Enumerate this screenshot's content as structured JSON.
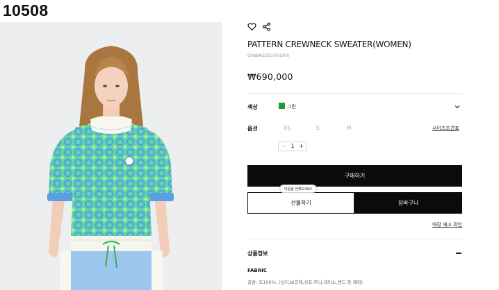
{
  "product_code_overlay": "10508",
  "product": {
    "name": "PATTERN CREWNECK SWEATER(WOMEN)",
    "sku": "GNWAS25205GRX",
    "price": "₩690,000"
  },
  "icons": {
    "wishlist": "heart-icon",
    "share": "share-icon",
    "expand": "chevron-down-icon",
    "collapse": "minus-icon"
  },
  "color": {
    "label": "색상",
    "value": "그린",
    "swatch": "#1b9a3b"
  },
  "size": {
    "label": "옵션",
    "options": [
      "XS",
      "S",
      "M"
    ],
    "guide_label": "사이즈조견표"
  },
  "quantity": {
    "minus": "−",
    "value": "1",
    "plus": "+"
  },
  "buttons": {
    "buy": "구매하기",
    "gift": "선물하기",
    "cart": "장바구니",
    "gift_tooltip": "마음을 전해보세요!"
  },
  "stock_check": "매장 재고 확인",
  "info": {
    "label": "상품정보",
    "fabric_label": "FABRIC",
    "fabric_detail": "겉감: 모100%, (심지,보강재,상표,무늬,레이스,밴드 등 제외)"
  },
  "colors": {
    "primary_button": "#0b0b0b",
    "border": "#e3e3e3"
  }
}
